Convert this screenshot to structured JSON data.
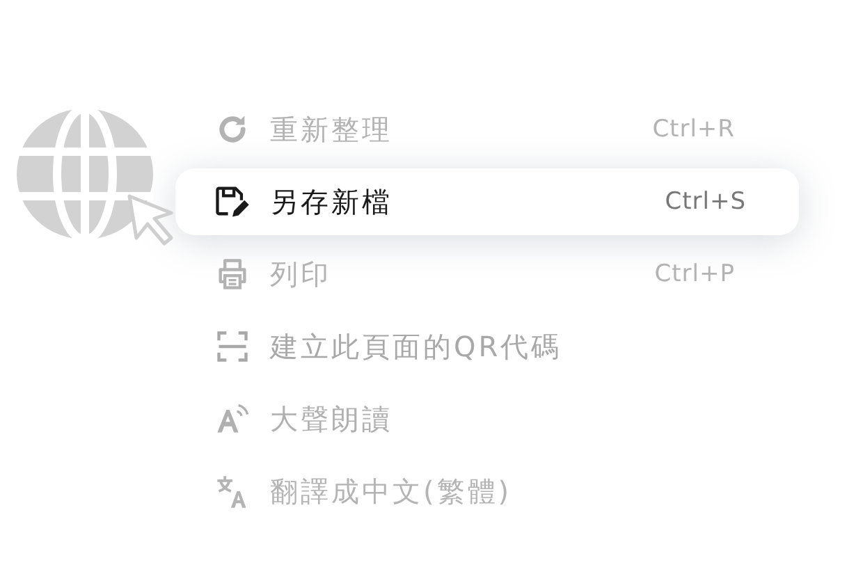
{
  "menu": {
    "items": [
      {
        "kind": "reload",
        "label": "重新整理",
        "shortcut": "Ctrl+R",
        "selected": false
      },
      {
        "kind": "save",
        "label": "另存新檔",
        "shortcut": "Ctrl+S",
        "selected": true
      },
      {
        "kind": "print",
        "label": "列印",
        "shortcut": "Ctrl+P",
        "selected": false
      },
      {
        "kind": "qr",
        "label": "建立此頁面的QR代碼",
        "selected": false
      },
      {
        "kind": "read",
        "label": "大聲朗讀",
        "selected": false
      },
      {
        "kind": "translate",
        "label": "翻譯成中文(繁體)",
        "selected": false
      }
    ]
  }
}
